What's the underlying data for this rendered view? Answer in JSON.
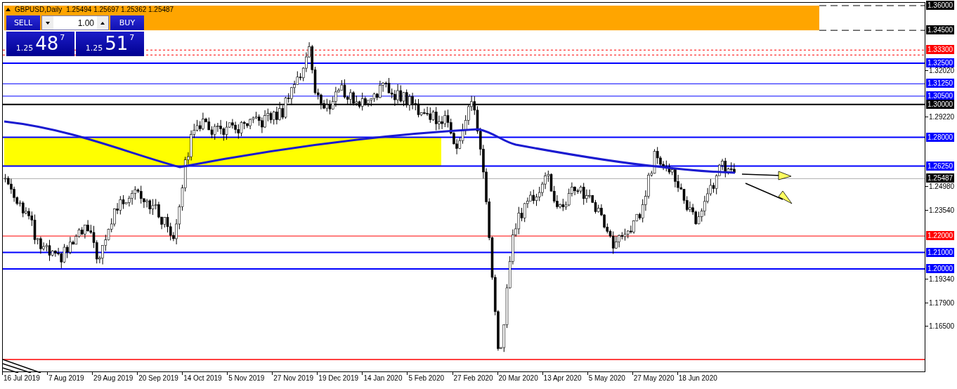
{
  "symbol_header": {
    "title": "GBPUSD,Daily",
    "ohlc": "1.25494 1.25697 1.25362 1.25487"
  },
  "trade_panel": {
    "sell_label": "SELL",
    "buy_label": "BUY",
    "lot": "1.00",
    "sell_price": {
      "prefix": "1.25",
      "big": "48",
      "point": "7"
    },
    "buy_price": {
      "prefix": "1.25",
      "big": "51",
      "point": "7"
    }
  },
  "chart": {
    "price_levels": [
      {
        "price": "1.36000",
        "color": "#000000",
        "kind": "dashed"
      },
      {
        "price": "1.34500",
        "color": "#000000",
        "kind": "dashed"
      },
      {
        "price": "1.33300",
        "color": "#ff0000",
        "kind": "dotted"
      },
      {
        "price": "1.32500",
        "color": "#0000ff",
        "kind": "thick"
      },
      {
        "price": "1.31250",
        "color": "#0000ff",
        "kind": "thin"
      },
      {
        "price": "1.30500",
        "color": "#0000ff",
        "kind": "thin"
      },
      {
        "price": "1.30000",
        "color": "#000000",
        "kind": "thick"
      },
      {
        "price": "1.28000",
        "color": "#0000ff",
        "kind": "thick"
      },
      {
        "price": "1.26250",
        "color": "#0000ff",
        "kind": "thick"
      },
      {
        "price": "1.25487",
        "color": "#000000",
        "kind": "current"
      },
      {
        "price": "1.22000",
        "color": "#ff0000",
        "kind": "thin"
      },
      {
        "price": "1.21000",
        "color": "#0000ff",
        "kind": "thick"
      },
      {
        "price": "1.20000",
        "color": "#0000ff",
        "kind": "thick"
      }
    ],
    "price_ticks": [
      "1.32020",
      "1.29220",
      "1.24980",
      "1.23540",
      "1.19340",
      "1.17900",
      "1.16500"
    ],
    "date_labels": [
      "16 Jul 2019",
      "7 Aug 2019",
      "29 Aug 2019",
      "20 Sep 2019",
      "14 Oct 2019",
      "5 Nov 2019",
      "27 Nov 2019",
      "19 Dec 2019",
      "14 Jan 2020",
      "5 Feb 2020",
      "27 Feb 2020",
      "20 Mar 2020",
      "13 Apr 2020",
      "5 May 2020",
      "27 May 2020",
      "18 Jun 2020"
    ]
  }
}
